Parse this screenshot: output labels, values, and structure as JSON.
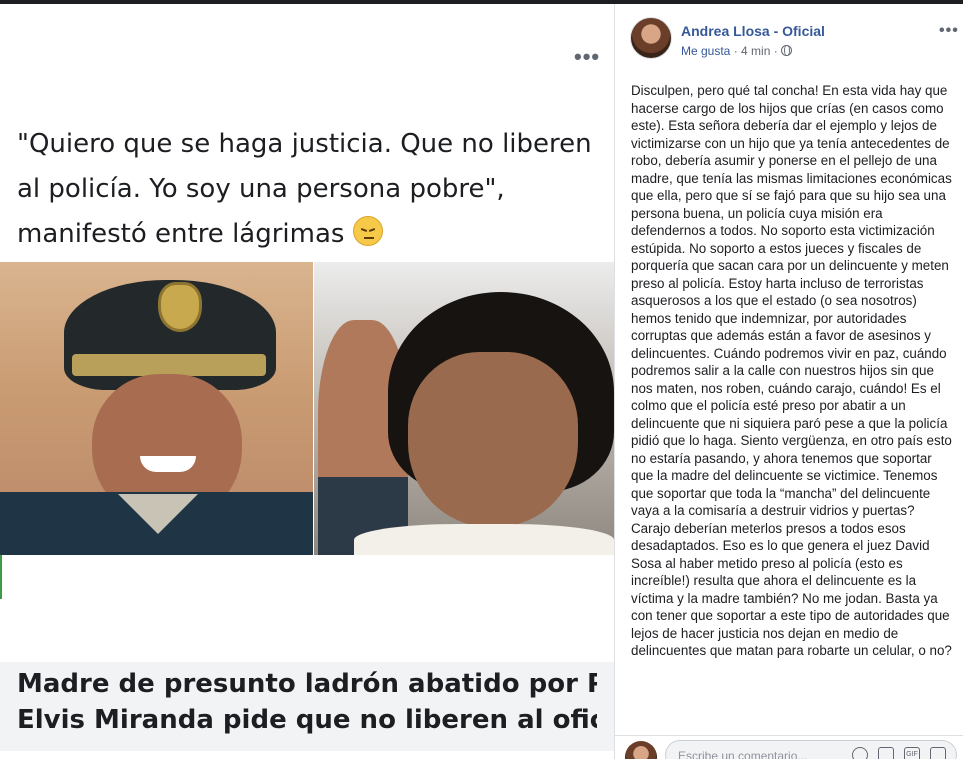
{
  "media": {
    "more_label": "•••",
    "quote": "\"Quiero que se haga justicia. Que no liberen al policía. Yo soy una persona pobre\", manifestó entre lágrimas",
    "emoji": "pensive-face",
    "headline_line1": "Madre de presunto ladrón abatido por PNP",
    "headline_line2": "Elvis Miranda pide que no liberen al oficial…"
  },
  "post": {
    "author": "Andrea Llosa - Oficial",
    "like_label": "Me gusta",
    "separator": " · ",
    "time": "4 min",
    "time_separator": " · ",
    "privacy_icon": "globe-icon",
    "options_label": "•••",
    "body": "Disculpen, pero qué tal concha! En esta vida hay que hacerse cargo de los hijos que crías (en casos como este). Esta señora debería dar el ejemplo y lejos de victimizarse con un hijo que ya tenía antecedentes de robo, debería asumir y ponerse en el pellejo de una madre, que tenía las mismas limitaciones económicas que ella, pero que sí se fajó para que su hijo sea una persona buena, un policía cuya misión era defendernos a todos. No soporto esta victimización estúpida. No soporto a estos jueces y fiscales de porquería que sacan cara por un delincuente y meten preso al policía. Estoy harta incluso de terroristas asquerosos a los que el estado (o sea nosotros) hemos tenido que indemnizar, por autoridades corruptas que además están a favor de asesinos y delincuentes. Cuándo podremos vivir en paz, cuándo podremos salir a la calle con nuestros hijos sin que nos maten, nos roben, cuándo carajo, cuándo! Es el colmo que el policía esté preso por abatir a un delincuente que ni siquiera paró pese a que la policía pidió que lo haga. Siento vergüenza, en otro país esto no estaría pasando, y ahora tenemos que soportar que la madre del delincuente se victimice. Tenemos que soportar que toda la “mancha” del delincuente vaya a la comisaría a destruir vidrios y puertas? Carajo deberían meterlos presos a todos esos desadaptados. Eso es lo que genera el juez David Sosa al haber metido preso al policía (esto es increíble!) resulta que ahora el delincuente es la víctima y la madre también? No me jodan. Basta ya con tener que soportar a este tipo de autoridades que lejos de hacer justicia nos dejan en medio de delincuentes que matan para robarte un celular, o no?"
  },
  "comment": {
    "placeholder": "Escribe un comentario...",
    "icons": [
      "emoji-icon",
      "camera-icon",
      "gif-icon",
      "sticker-icon"
    ],
    "gif_label": "GIF"
  },
  "colors": {
    "link_blue": "#365899",
    "text": "#1c1e21",
    "muted": "#606770",
    "headline_bg": "#f2f3f5"
  }
}
